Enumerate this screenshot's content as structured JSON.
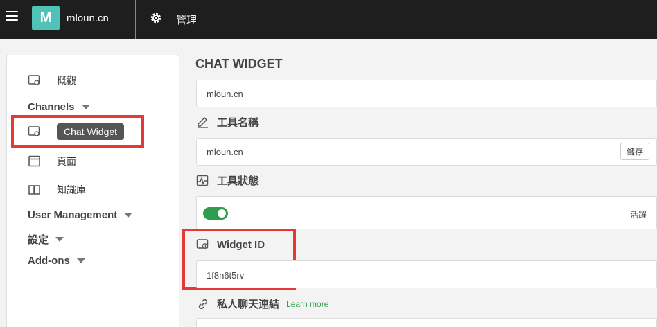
{
  "header": {
    "logo_letter": "M",
    "site_name": "mloun.cn",
    "admin_label": "管理",
    "icons": [
      "hamburger-icon",
      "gear-icon"
    ]
  },
  "sidebar": {
    "overview": "概觀",
    "channels": "Channels",
    "chat_widget": "Chat Widget",
    "pages": "頁面",
    "knowledge_base": "知識庫",
    "user_management": "User Management",
    "settings": "設定",
    "addons": "Add-ons"
  },
  "main": {
    "title": "CHAT WIDGET",
    "top_value": "mloun.cn",
    "tool_name_label": "工具名稱",
    "tool_name_value": "mloun.cn",
    "save_label": "儲存",
    "tool_status_label": "工具狀態",
    "status_value": "活躍",
    "widget_id_label": "Widget ID",
    "widget_id_value": "1f8n6t5rv",
    "private_link_label": "私人聊天連結",
    "learn_more": "Learn more"
  },
  "colors": {
    "topbar": "#1e1e1e",
    "logo": "#4fc3b7",
    "toggle_on": "#2e9e4e",
    "highlight": "#e53935"
  }
}
